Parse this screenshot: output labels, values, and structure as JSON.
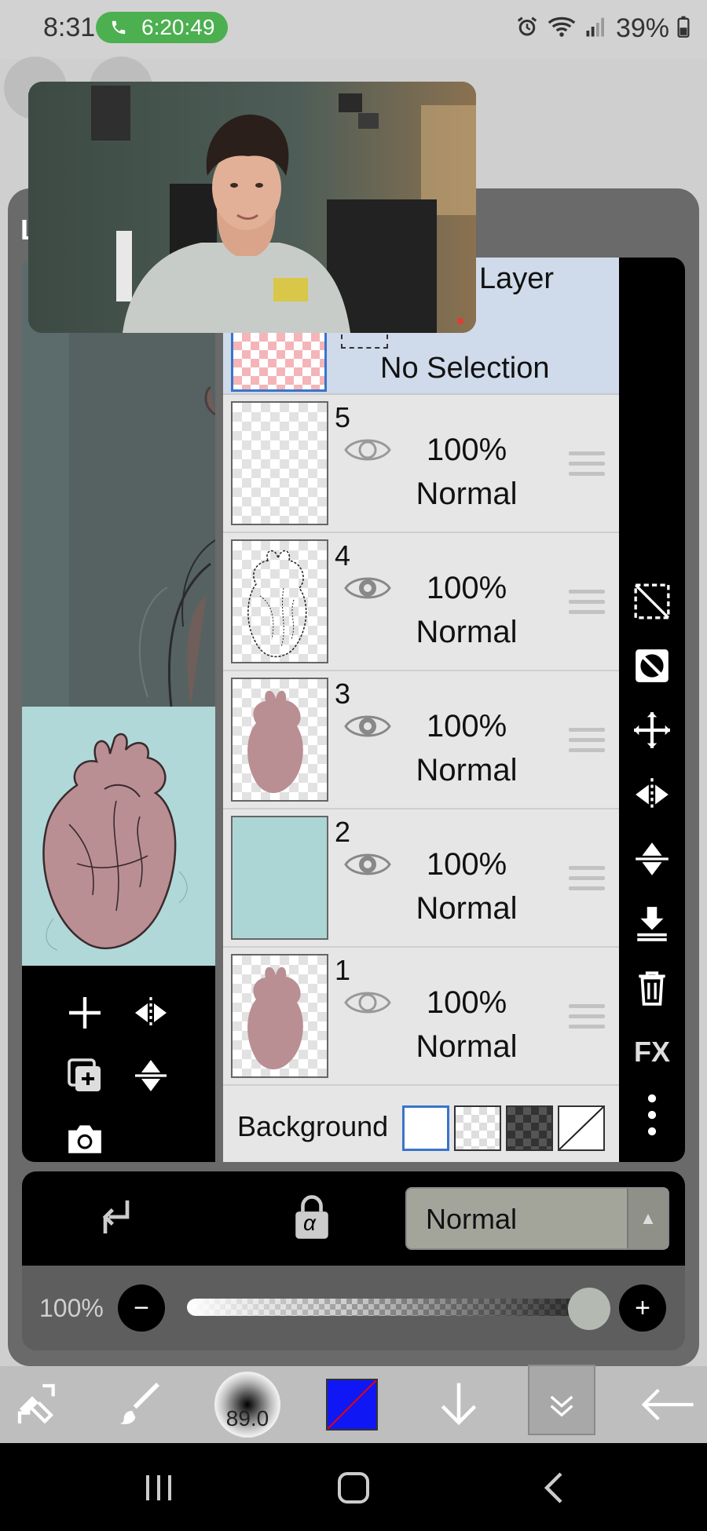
{
  "status_bar": {
    "time": "8:31",
    "call_timer": "6:20:49",
    "battery": "39%"
  },
  "dialog": {
    "title_letter": "L"
  },
  "layers_panel": {
    "header_title": "Layer",
    "selection_label": "No Selection",
    "layers": [
      {
        "number": "5",
        "opacity": "100%",
        "blend": "Normal",
        "visible": true,
        "content": "empty"
      },
      {
        "number": "4",
        "opacity": "100%",
        "blend": "Normal",
        "visible": true,
        "content": "line-art"
      },
      {
        "number": "3",
        "opacity": "100%",
        "blend": "Normal",
        "visible": true,
        "content": "heart-fill"
      },
      {
        "number": "2",
        "opacity": "100%",
        "blend": "Normal",
        "visible": true,
        "content": "teal-solid"
      },
      {
        "number": "1",
        "opacity": "100%",
        "blend": "Normal",
        "visible": false,
        "content": "heart-fill"
      }
    ],
    "background_label": "Background"
  },
  "right_toolbar": {
    "fx_label": "FX",
    "icons": [
      "select-clear-icon",
      "mask-icon",
      "move-icon",
      "flip-horizontal-icon",
      "flip-vertical-icon",
      "merge-down-icon",
      "trash-icon",
      "fx-button",
      "more-icon"
    ]
  },
  "blend_bar": {
    "blend_mode": "Normal",
    "alpha_symbol": "α"
  },
  "opacity_bar": {
    "label": "100%",
    "value": 1.0,
    "minus": "−",
    "plus": "+"
  },
  "bottom_toolbar": {
    "brush_size": "89.0",
    "color_hex": "#1017f5"
  },
  "colors": {
    "layer_header_bg": "#cfdaea",
    "selected_border": "#3a74c9",
    "teal_layer": "#acd6d6",
    "heart": "#b98f94"
  }
}
